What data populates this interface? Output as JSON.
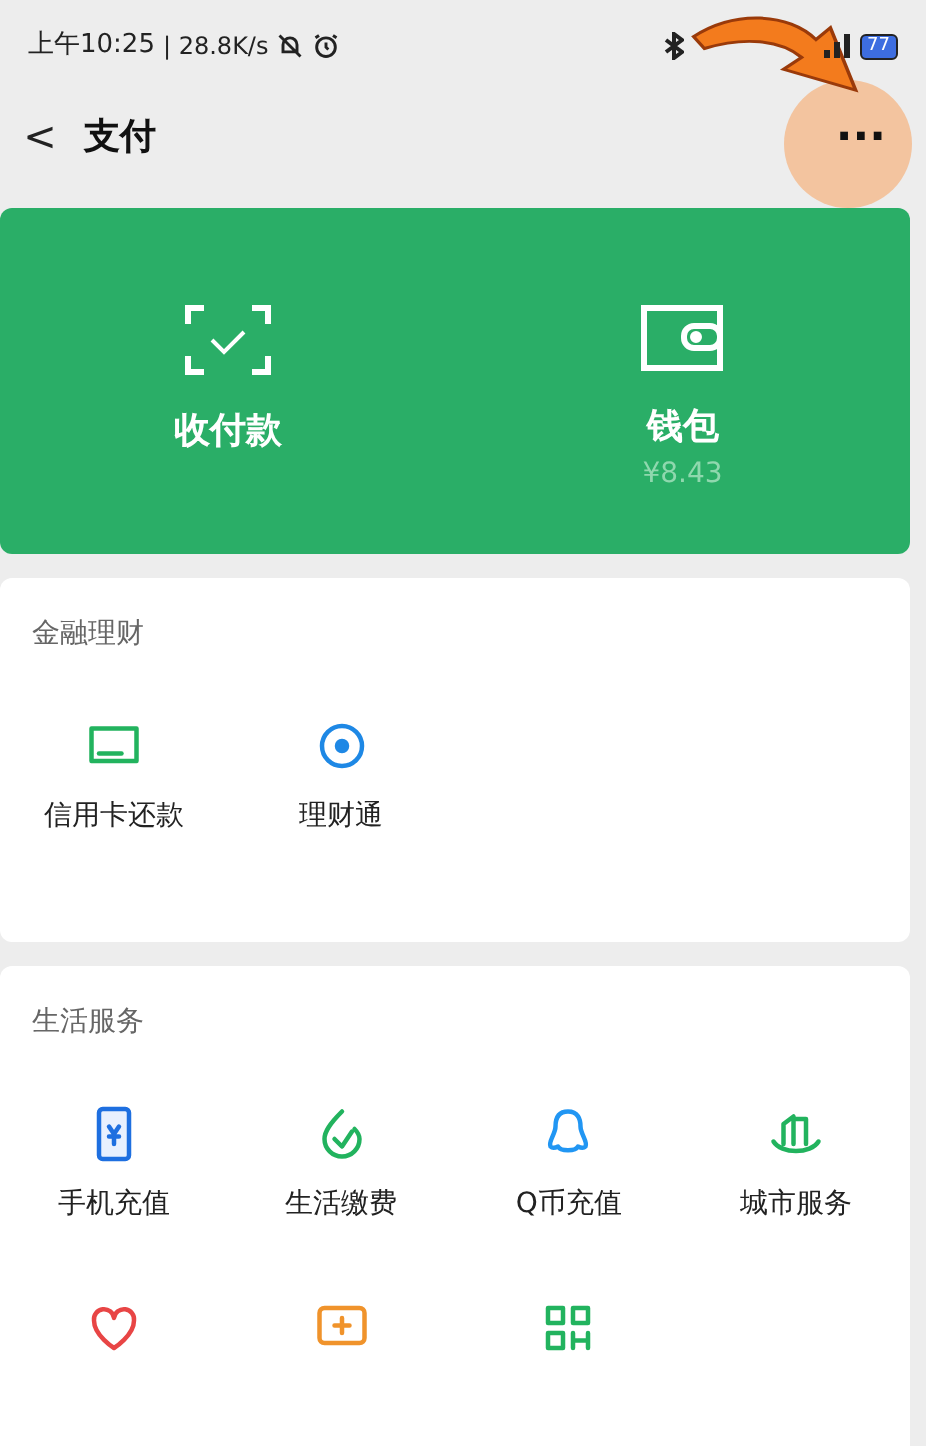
{
  "status_bar": {
    "time": "上午10:25",
    "separator": "|",
    "speed": "28.8K/s",
    "battery": "77"
  },
  "header": {
    "back": "<",
    "title": "支付",
    "more": "..."
  },
  "hero": [
    {
      "kind": "scan",
      "label": "收付款"
    },
    {
      "kind": "wallet",
      "label": "钱包",
      "sub": "¥8.43"
    }
  ],
  "sections": [
    {
      "title": "金融理财",
      "items": [
        {
          "kind": "labeled",
          "label": "信用卡还款"
        },
        {
          "kind": "labeled",
          "label": "理财通"
        }
      ]
    },
    {
      "title": "生活服务",
      "items": [
        {
          "kind": "labeled",
          "label": "手机充值"
        },
        {
          "kind": "labeled",
          "label": "生活缴费"
        },
        {
          "kind": "labeled",
          "label": "Q币充值"
        },
        {
          "kind": "labeled",
          "label": "城市服务"
        },
        {
          "kind": "icon"
        },
        {
          "kind": "icon"
        },
        {
          "kind": "icon"
        }
      ]
    }
  ]
}
